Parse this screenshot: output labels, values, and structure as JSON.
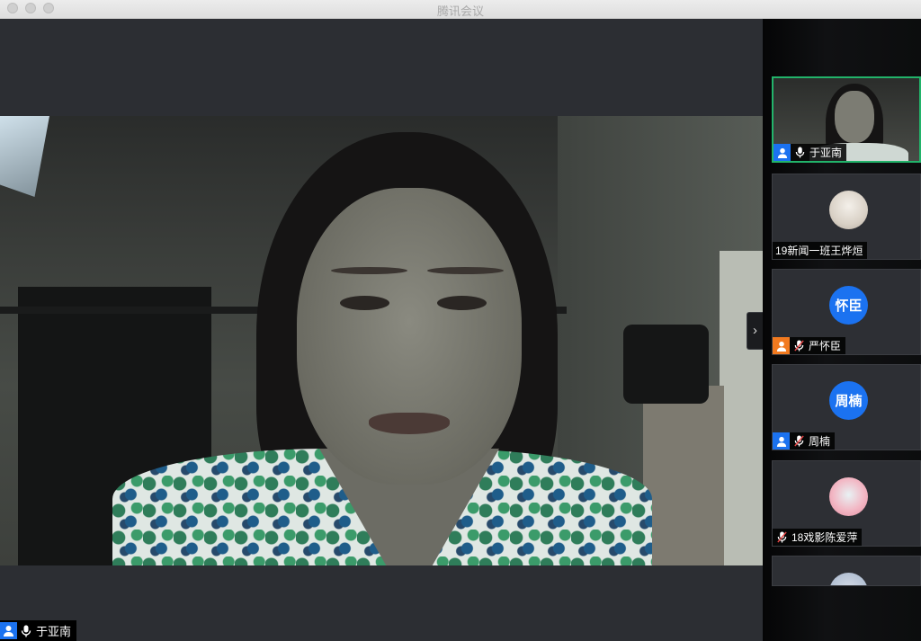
{
  "window": {
    "title": "腾讯会议"
  },
  "main": {
    "speaker_name": "于亚南"
  },
  "participants": [
    {
      "name": "于亚南",
      "avatar_text": "",
      "role_icon": "user-icon",
      "mic": "mic-on",
      "active": true
    },
    {
      "name": "19新闻一班王烨烜",
      "avatar_text": "",
      "role_icon": "",
      "mic": "",
      "active": false
    },
    {
      "name": "严怀臣",
      "avatar_text": "怀臣",
      "role_icon": "user-icon",
      "mic": "mic-muted",
      "active": false
    },
    {
      "name": "周楠",
      "avatar_text": "周楠",
      "role_icon": "user-icon",
      "mic": "mic-muted",
      "active": false
    },
    {
      "name": "18戏影陈爱萍",
      "avatar_text": "",
      "role_icon": "",
      "mic": "mic-muted",
      "active": false
    },
    {
      "name": "",
      "avatar_text": "",
      "role_icon": "",
      "mic": "",
      "active": false
    }
  ],
  "colors": {
    "accent_green": "#22b36a",
    "avatar_blue": "#1b72f0",
    "host_orange": "#f27a1f"
  }
}
